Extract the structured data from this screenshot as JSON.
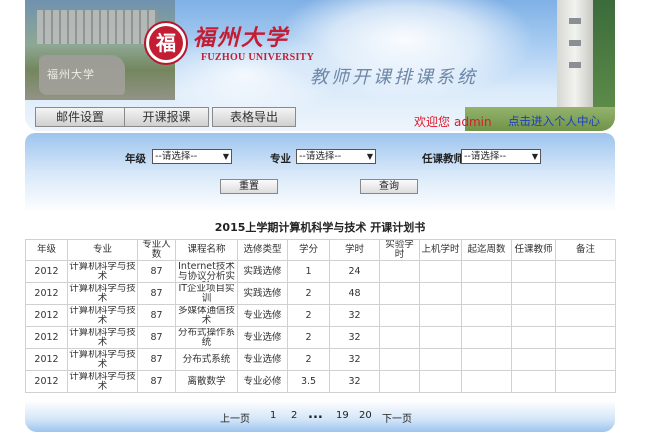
{
  "banner": {
    "logo_char": "福",
    "university_name": "福州大学",
    "university_en": "FUZHOU UNIVERSITY",
    "stone_text": "福州大学",
    "system_title": "教师开课排课系统"
  },
  "nav": {
    "tabs": [
      {
        "label": "邮件设置"
      },
      {
        "label": "开课报课"
      },
      {
        "label": "表格导出"
      }
    ],
    "welcome_text": "欢迎您",
    "username": "admin",
    "personal_link": "点击进入个人中心"
  },
  "filters": {
    "grade_label": "年级",
    "grade_value": "--请选择--",
    "major_label": "专业",
    "major_value": "--请选择--",
    "teacher_label": "任课教师",
    "teacher_value": "--请选择--",
    "reset_label": "重置",
    "query_label": "查询"
  },
  "table": {
    "title": "2015上学期计算机科学与技术 开课计划书",
    "headers": [
      "年级",
      "专业",
      "专业人数",
      "课程名称",
      "选修类型",
      "学分",
      "学时",
      "实验学时",
      "上机学时",
      "起迄周数",
      "任课教师",
      "备注"
    ],
    "rows": [
      [
        "2012",
        "计算机科学与技术",
        "87",
        "Internet技术与协议分析实验",
        "实践选修",
        "1",
        "24",
        "",
        "",
        "",
        "",
        ""
      ],
      [
        "2012",
        "计算机科学与技术",
        "87",
        "IT企业项目实训",
        "实践选修",
        "2",
        "48",
        "",
        "",
        "",
        "",
        ""
      ],
      [
        "2012",
        "计算机科学与技术",
        "87",
        "多媒体通信技术",
        "专业选修",
        "2",
        "32",
        "",
        "",
        "",
        "",
        ""
      ],
      [
        "2012",
        "计算机科学与技术",
        "87",
        "分布式操作系统",
        "专业选修",
        "2",
        "32",
        "",
        "",
        "",
        "",
        ""
      ],
      [
        "2012",
        "计算机科学与技术",
        "87",
        "分布式系统",
        "专业选修",
        "2",
        "32",
        "",
        "",
        "",
        "",
        ""
      ],
      [
        "2012",
        "计算机科学与技术",
        "87",
        "离散数学",
        "专业必修",
        "3.5",
        "32",
        "",
        "",
        "",
        "",
        ""
      ]
    ]
  },
  "pager": {
    "prev": "上一页",
    "p1": "1",
    "p2": "2",
    "ellipsis": "...",
    "p19": "19",
    "p20": "20",
    "next": "下一页"
  },
  "colors": {
    "accent_red": "#c31d34",
    "welcome_red": "#e2172a",
    "link_blue": "#1a3fc2",
    "panel_blue": "#9dc4ee"
  }
}
